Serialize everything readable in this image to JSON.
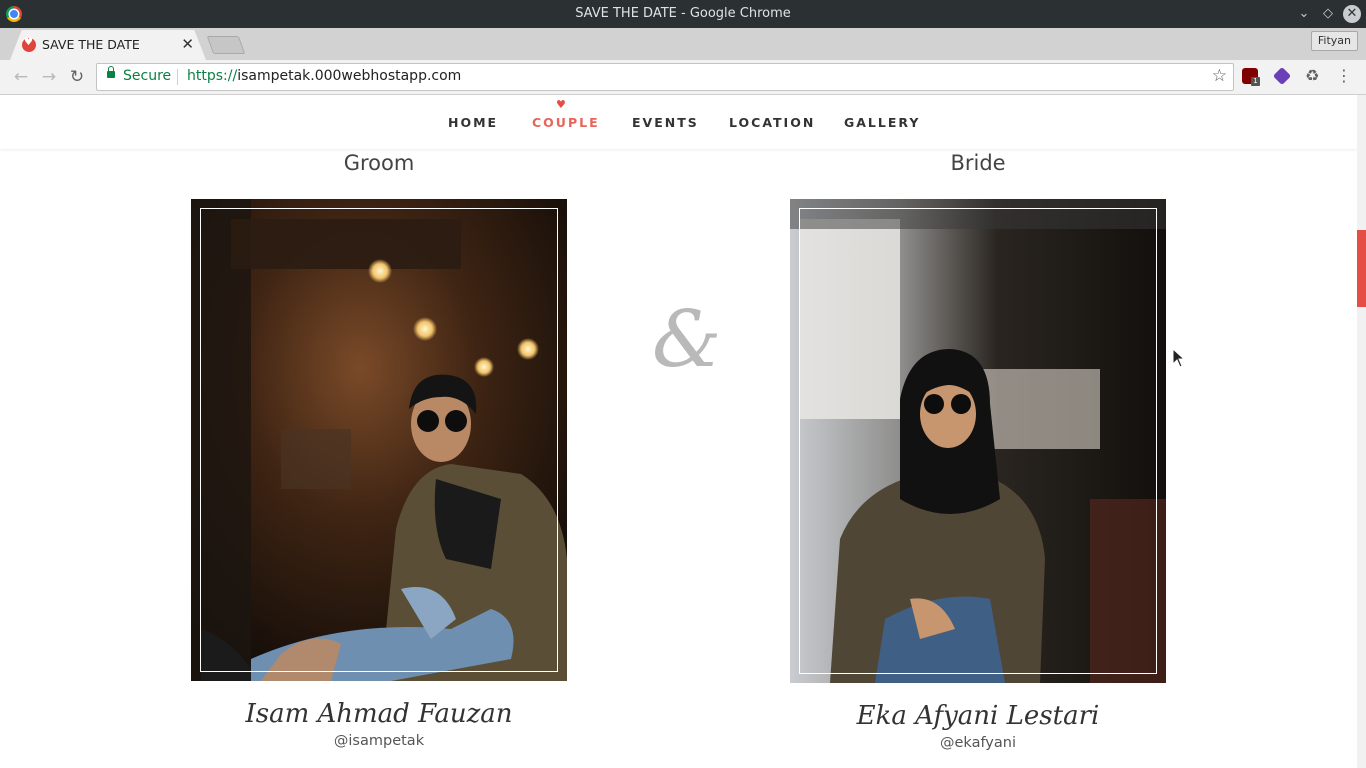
{
  "window": {
    "title": "SAVE THE DATE - Google Chrome",
    "profile": "Fityan"
  },
  "tab": {
    "title": "SAVE THE DATE"
  },
  "toolbar": {
    "secure_label": "Secure",
    "url_scheme": "https://",
    "url_host": "isampetak.000webhostapp.com",
    "ublock_badge": "1"
  },
  "nav": {
    "items": [
      "HOME",
      "COUPLE",
      "EVENTS",
      "LOCATION",
      "GALLERY"
    ],
    "active": "COUPLE"
  },
  "couple": {
    "groom": {
      "title": "Groom",
      "name": "Isam Ahmad Fauzan",
      "handle": "@isampetak"
    },
    "bride": {
      "title": "Bride",
      "name": "Eka Afyani Lestari",
      "handle": "@ekafyani"
    },
    "ampersand": "&"
  },
  "colors": {
    "accent": "#e8635a",
    "titlebar": "#2b3033"
  }
}
